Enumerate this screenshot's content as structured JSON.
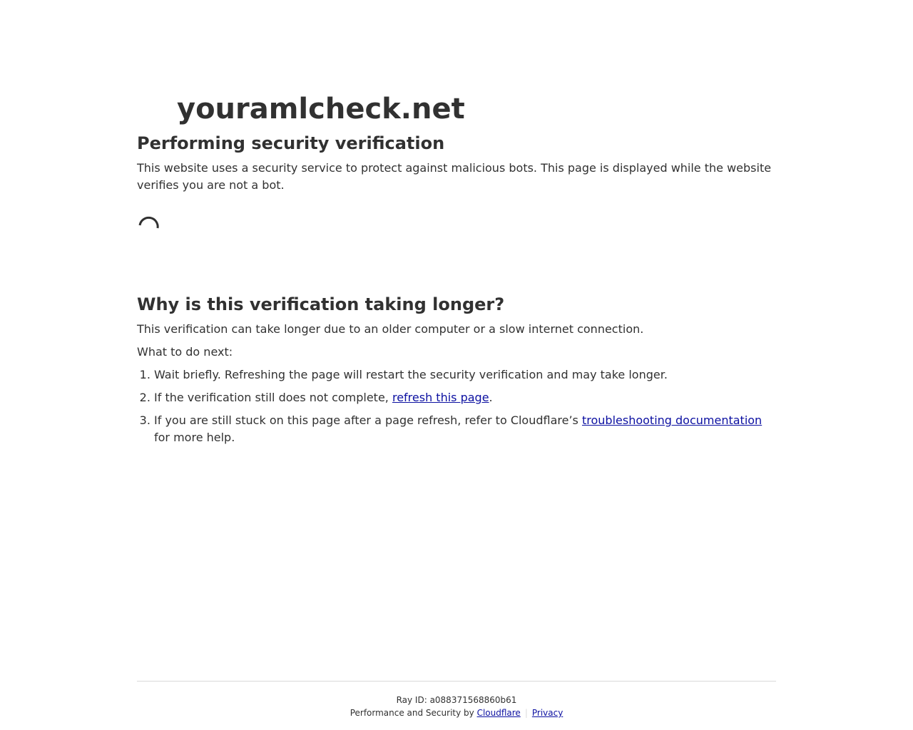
{
  "site": {
    "title": "youramlcheck.net"
  },
  "verification": {
    "heading": "Performing security verification",
    "description": "This website uses a security service to protect against malicious bots. This page is displayed while the website verifies you are not a bot."
  },
  "spinner": {
    "icon": "loading-spinner-icon"
  },
  "why": {
    "heading": "Why is this verification taking longer?",
    "older": "This verification can take longer due to an older computer or a slow internet connection.",
    "next": "What to do next:",
    "steps": [
      {
        "text": "Wait briefly. Refreshing the page will restart the security verification and may take longer."
      },
      {
        "before": "If the verification still does not complete, ",
        "link": "refresh this page",
        "after": "."
      },
      {
        "before": "If you are still stuck on this page after a page refresh, refer to Cloudflare’s ",
        "link": "troubleshooting documentation",
        "after": " for more help."
      }
    ]
  },
  "footer": {
    "ray_label": "Ray ID: ",
    "ray_id": "a088371568860b61",
    "perf_text": "Performance and Security by ",
    "cloudflare_link": "Cloudflare",
    "separator": "|",
    "privacy_link": "Privacy"
  },
  "colors": {
    "text": "#313131",
    "link": "#0c10a1",
    "divider": "#d9d9d9",
    "background": "#ffffff"
  }
}
